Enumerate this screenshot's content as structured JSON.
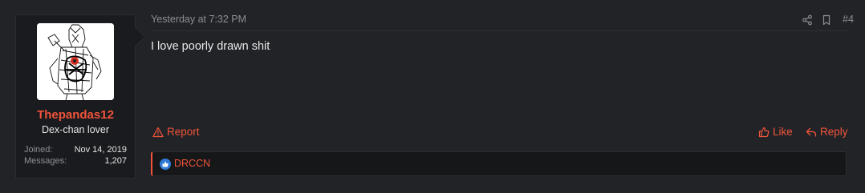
{
  "user": {
    "username": "Thepandas12",
    "title": "Dex-chan lover",
    "stats": [
      {
        "label": "Joined:",
        "value": "Nov 14, 2019"
      },
      {
        "label": "Messages:",
        "value": "1,207"
      }
    ]
  },
  "post": {
    "timestamp": "Yesterday at 7:32 PM",
    "number": "#4",
    "message": "I love poorly drawn shit"
  },
  "actions": {
    "report": "Report",
    "like": "Like",
    "reply": "Reply"
  },
  "reactions": {
    "users": "DRCCN",
    "icon": "like-reaction-icon"
  },
  "colors": {
    "accent": "#f1543b",
    "background": "#222327",
    "panel": "#1a1b1e",
    "reaction_blue": "#2f7bd6"
  }
}
